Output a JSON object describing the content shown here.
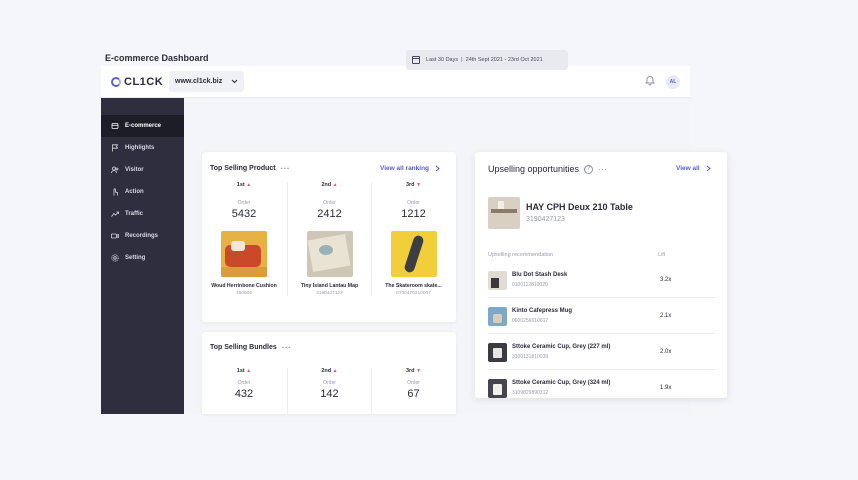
{
  "app": {
    "logo": "CL1CK",
    "domain": "www.cl1ck.biz",
    "avatar": "AL"
  },
  "sidebar": {
    "items": [
      {
        "label": "E-commerce",
        "icon": "cart-icon",
        "active": true
      },
      {
        "label": "Highlights",
        "icon": "flag-icon"
      },
      {
        "label": "Visitor",
        "icon": "users-icon"
      },
      {
        "label": "Action",
        "icon": "pointer-icon"
      },
      {
        "label": "Traffic",
        "icon": "trend-icon"
      },
      {
        "label": "Recordings",
        "icon": "video-icon"
      },
      {
        "label": "Setting",
        "icon": "gear-icon"
      }
    ]
  },
  "header": {
    "title": "E-commerce Dashboard",
    "date_range": "Last 30 Days  |  24th Sept 2021 - 23rd Oct 2021"
  },
  "top_selling_product": {
    "title": "Top Selling Product",
    "view_all": "View all ranking",
    "order_label": "Order",
    "items": [
      {
        "rank": "1st",
        "trend": "up",
        "order": "5432",
        "name": "Woud Herrinbone Cushion",
        "id": "160506"
      },
      {
        "rank": "2nd",
        "trend": "up",
        "order": "2412",
        "name": "Tiny Island Lantau Map",
        "id": "3190427123"
      },
      {
        "rank": "3rd",
        "trend": "down",
        "order": "1212",
        "name": "The Skateroom skate...",
        "id": "0700470210007"
      }
    ]
  },
  "top_selling_bundles": {
    "title": "Top Selling Bundles",
    "order_label": "Order",
    "items": [
      {
        "rank": "1st",
        "trend": "up",
        "order": "432"
      },
      {
        "rank": "2nd",
        "trend": "up",
        "order": "142"
      },
      {
        "rank": "3rd",
        "trend": "down",
        "order": "67"
      }
    ]
  },
  "upselling": {
    "title": "Upselling opportunities",
    "view_all": "View all",
    "product_name": "HAY CPH Deux 210 Table",
    "product_id": "3190427123",
    "col_recommendation": "Upselling recommendation",
    "col_lift": "Lift",
    "rows": [
      {
        "name": "Blu Dot Stash Desk",
        "id": "0100112810020",
        "lift": "3.2x"
      },
      {
        "name": "Kinto Cafepress Mug",
        "id": "0600256610017",
        "lift": "2.1x"
      },
      {
        "name": "Sttoke Ceramic Cup, Grey (227 ml)",
        "id": "3100131810039",
        "lift": "2.0x"
      },
      {
        "name": "Sttoke Ceramic Cup, Grey (324 ml)",
        "id": "3109829890312",
        "lift": "1.9x"
      }
    ]
  },
  "colors": {
    "accent": "#5b5fc7",
    "sidebar": "#2e2e3e",
    "trend": "#d75a70"
  }
}
